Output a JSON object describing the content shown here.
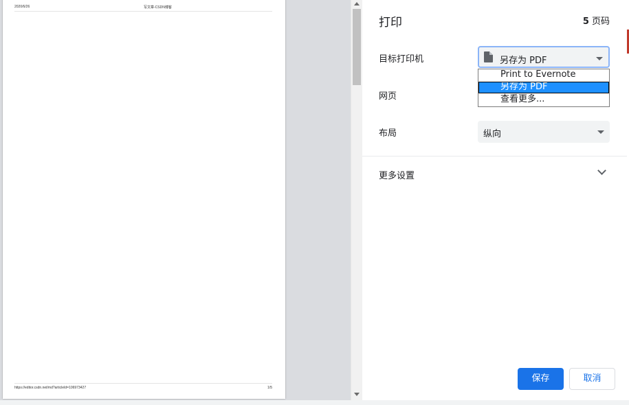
{
  "preview": {
    "header_date": "2020/6/26",
    "header_title": "写文章-CSDN博客",
    "footer_url": "https://editor.csdn.net/md?articleId=106973427",
    "footer_page": "1/5"
  },
  "settings": {
    "title": "打印",
    "page_count_number": "5",
    "page_count_suffix": " 页码",
    "destination_label": "目标打印机",
    "destination_value": "另存为 PDF",
    "pages_label": "网页",
    "layout_label": "布局",
    "layout_value": "纵向",
    "more_settings_label": "更多设置"
  },
  "destination_dropdown": {
    "options": [
      "Print to Evernote",
      "另存为 PDF",
      "查看更多..."
    ],
    "selected_index": 1
  },
  "buttons": {
    "save": "保存",
    "cancel": "取消"
  },
  "colors": {
    "accent": "#1a73e8",
    "selected_option": "#1e90ff",
    "focus_ring": "#8ab4f8"
  },
  "icons": {
    "destination": "file-icon",
    "more_settings": "chevron-down-icon"
  }
}
